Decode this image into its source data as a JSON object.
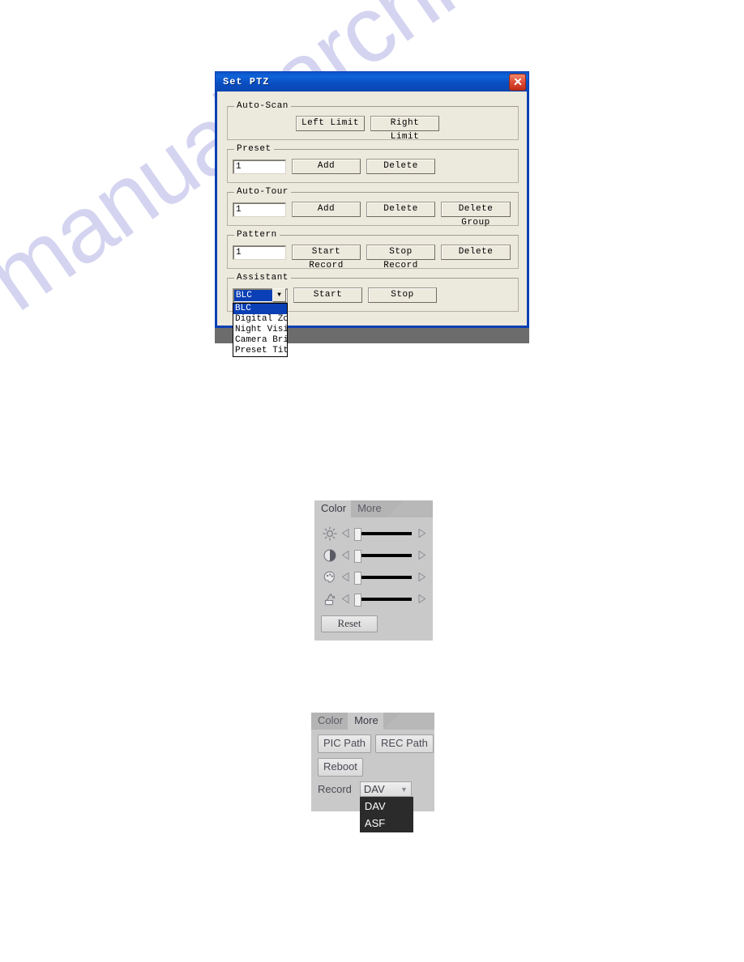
{
  "watermark": {
    "text": "manualsarchive.com",
    "color": "#cdcdef"
  },
  "ptz_dialog": {
    "title": "Set PTZ",
    "close_label": "✕",
    "groups": [
      {
        "legend": "Auto-Scan",
        "buttons": [
          "Left Limit",
          "Right Limit"
        ]
      },
      {
        "legend": "Preset",
        "input_value": "1",
        "buttons": [
          "Add",
          "Delete"
        ]
      },
      {
        "legend": "Auto-Tour",
        "input_value": "1",
        "buttons": [
          "Add",
          "Delete",
          "Delete Group"
        ]
      },
      {
        "legend": "Pattern",
        "input_value": "1",
        "buttons": [
          "Start Record",
          "Stop Record",
          "Delete"
        ]
      },
      {
        "legend": "Assistant",
        "combo_value": "BLC",
        "combo_options": [
          "BLC",
          "Digital Zoom",
          "Night Vision",
          "Camera Bright",
          "Preset Title"
        ],
        "buttons": [
          "Start",
          "Stop"
        ]
      }
    ]
  },
  "color_panel": {
    "tabs": [
      {
        "label": "Color",
        "active": true
      },
      {
        "label": "More",
        "active": false
      }
    ],
    "sliders": [
      {
        "icon": "brightness-icon",
        "value": 3
      },
      {
        "icon": "contrast-icon",
        "value": 3
      },
      {
        "icon": "hue-icon",
        "value": 3
      },
      {
        "icon": "saturation-icon",
        "value": 3
      }
    ],
    "reset_label": "Reset"
  },
  "more_panel": {
    "tabs": [
      {
        "label": "Color",
        "active": false
      },
      {
        "label": "More",
        "active": true
      }
    ],
    "buttons": [
      "PIC Path",
      "REC Path",
      "Reboot"
    ],
    "record_label": "Record",
    "record_value": "DAV",
    "record_options": [
      "DAV",
      "ASF"
    ],
    "dropdown_arrow": "▼"
  }
}
